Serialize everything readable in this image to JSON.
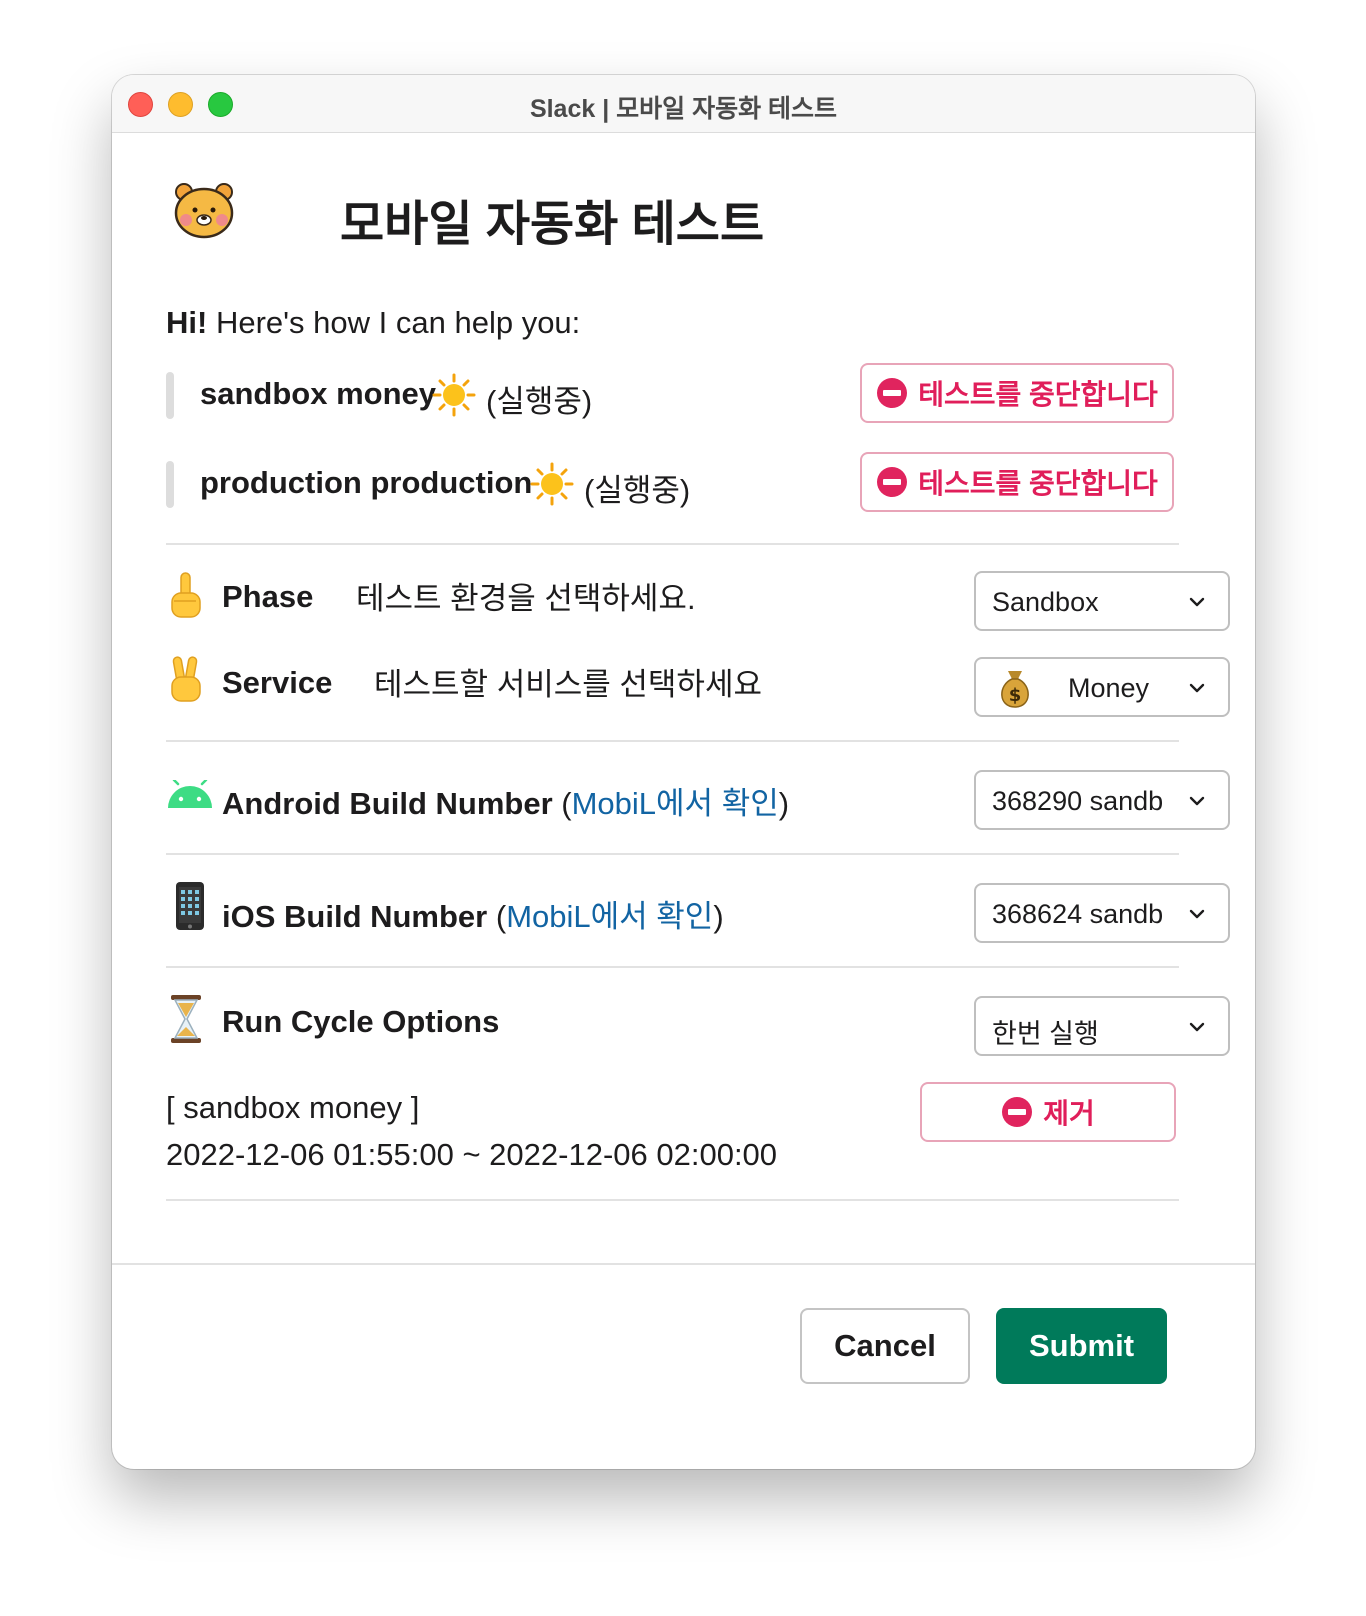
{
  "window": {
    "title": "Slack | 모바일 자동화 테스트"
  },
  "header": {
    "title": "모바일 자동화 테스트",
    "icon": "bear-face-icon"
  },
  "intro": {
    "bold": "Hi!",
    "text": " Here's how I can help you:"
  },
  "running_tests": [
    {
      "name": "sandbox money",
      "status": "(실행중)",
      "stop_label": "테스트를 중단합니다"
    },
    {
      "name": "production production",
      "status": "(실행중)",
      "stop_label": "테스트를 중단합니다"
    }
  ],
  "phase": {
    "label": "Phase",
    "hint": "테스트 환경을 선택하세요.",
    "selected": "Sandbox"
  },
  "service": {
    "label": "Service",
    "hint": "테스트할 서비스를 선택하세요",
    "selected": "Money"
  },
  "android": {
    "label": "Android Build Number",
    "paren_open": "(",
    "link": "MobiL에서 확인",
    "paren_close": ")",
    "selected": "368290 sandb"
  },
  "ios": {
    "label": "iOS Build Number",
    "paren_open": "(",
    "link": "MobiL에서 확인",
    "paren_close": ")",
    "selected": "368624 sandb"
  },
  "run_cycle": {
    "label": "Run Cycle Options",
    "selected": "한번 실행"
  },
  "schedule": {
    "name": "[ sandbox money ]",
    "time": "2022-12-06 01:55:00  ~ 2022-12-06 02:00:00",
    "remove_label": "제거"
  },
  "footer": {
    "cancel": "Cancel",
    "submit": "Submit"
  },
  "colors": {
    "danger": "#e01e5a",
    "link": "#1264a3",
    "submit": "#007a5a"
  }
}
